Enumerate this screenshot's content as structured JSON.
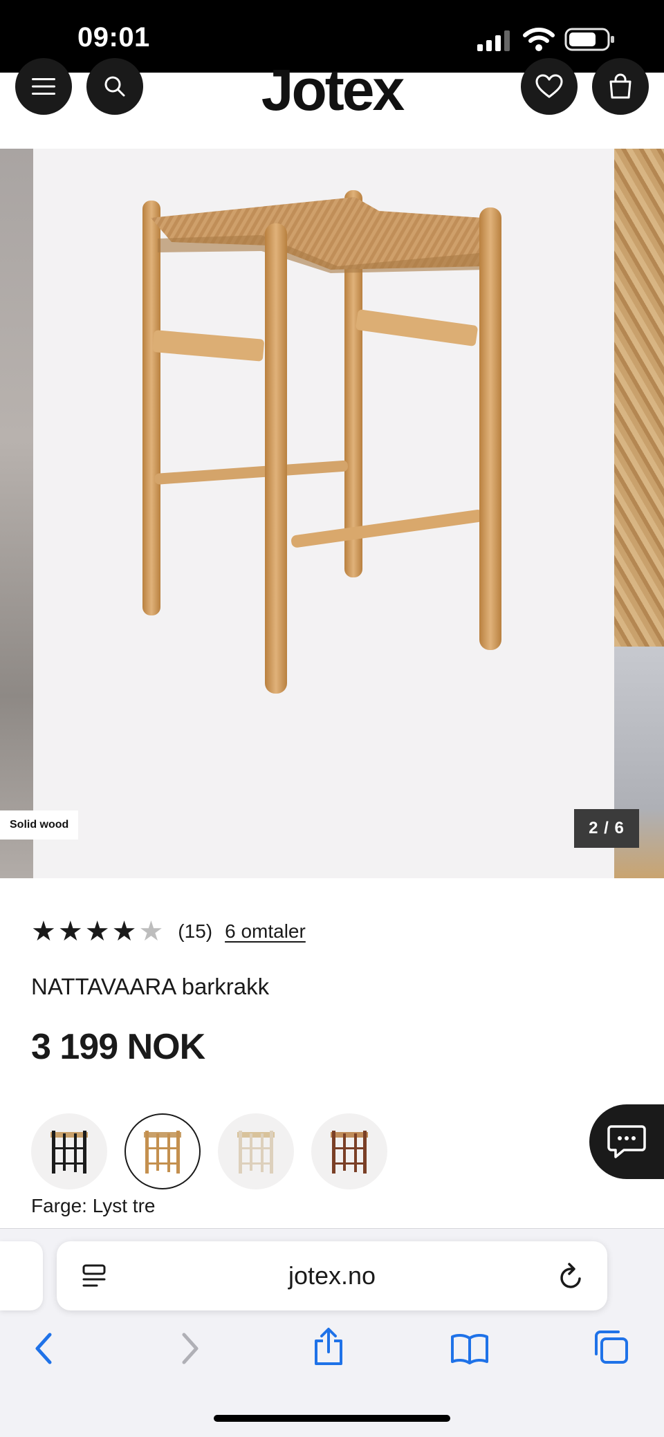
{
  "status_bar": {
    "time": "09:01"
  },
  "header": {
    "logo": "Jotex"
  },
  "gallery": {
    "badge": "Solid wood",
    "counter": "2 / 6"
  },
  "product": {
    "rating": 4,
    "rating_max": 5,
    "rating_count": "(15)",
    "reviews_link": "6 omtaler",
    "name": "NATTAVAARA barkrakk",
    "price": "3 199 NOK",
    "color_label": "Farge: Lyst tre",
    "swatches": [
      {
        "color": "#1c1c1c",
        "seat": "#c9a06a"
      },
      {
        "color": "#c4904f",
        "seat": "#c9a06a",
        "selected": true
      },
      {
        "color": "#ddd0bc",
        "seat": "#d8c29b"
      },
      {
        "color": "#7a3f26",
        "seat": "#c08c5a"
      }
    ]
  },
  "browser": {
    "url": "jotex.no"
  },
  "colors": {
    "dark": "#1a1a1a",
    "ios_blue": "#1f72e8",
    "gallery_bg": "#f3f2f3"
  }
}
